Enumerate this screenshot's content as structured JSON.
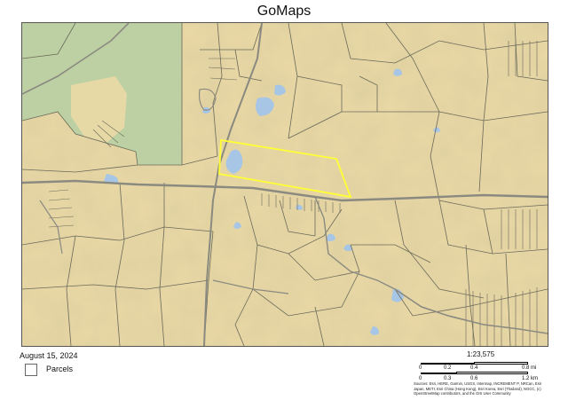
{
  "title": "GoMaps",
  "date": "August 15, 2024",
  "legend": {
    "parcels_label": "Parcels"
  },
  "scale": {
    "ratio": "1:23,575",
    "mi_ticks": [
      "0",
      "0.2",
      "0.4",
      "0.8 mi"
    ],
    "km_ticks": [
      "0",
      "0.3",
      "0.6",
      "1.2 km"
    ]
  },
  "attribution": "Sources: Esri, HERE, Garmin, USGS, Intermap, INCREMENT P, NRCan, Esri Japan, METI, Esri China (Hong Kong), Esri Korea, Esri (Thailand), NGCC, (c) OpenStreetMap contributors, and the GIS User Community",
  "colors": {
    "terrain": "#ead9a6",
    "forest": "#b9cfa3",
    "water": "#a7c6e6",
    "parcel_lines": "#6a6a5a",
    "roads": "#8a8a80",
    "highlight": "#ffff33"
  }
}
